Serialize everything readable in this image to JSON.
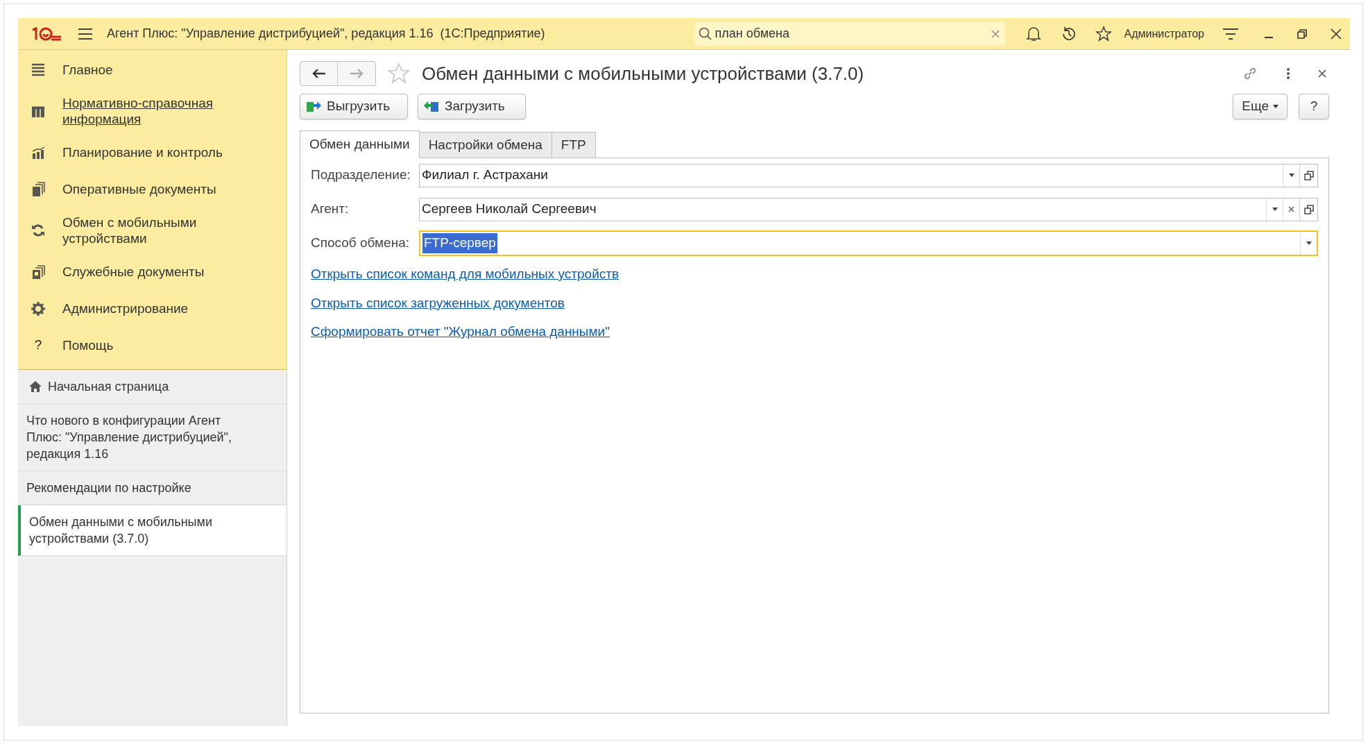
{
  "header": {
    "title": "Агент Плюс: \"Управление дистрибуцией\", редакция 1.16  (1С:Предприятие)",
    "search": {
      "value": "план обмена"
    },
    "user": "Администратор"
  },
  "sidebar": {
    "sections": [
      {
        "label": "Главное",
        "kind": "list",
        "underlined": false
      },
      {
        "label": "Нормативно-справочная информация",
        "kind": "grid",
        "underlined": true
      },
      {
        "label": "Планирование и контроль",
        "kind": "chart",
        "underlined": false
      },
      {
        "label": "Оперативные документы",
        "kind": "docs",
        "underlined": false
      },
      {
        "label": "Обмен с мобильными устройствами",
        "kind": "sync",
        "underlined": false
      },
      {
        "label": "Служебные документы",
        "kind": "service",
        "underlined": false
      },
      {
        "label": "Администрирование",
        "kind": "gear",
        "underlined": false
      },
      {
        "label": "Помощь",
        "kind": "help",
        "icon_char": "?",
        "underlined": false
      }
    ],
    "open_windows": [
      {
        "label": "Начальная страница",
        "kind": "home",
        "selected": false
      },
      {
        "label": "Что нового в конфигурации Агент Плюс: \"Управление дистрибуцией\", редакция 1.16",
        "kind": "page",
        "selected": false
      },
      {
        "label": "Рекомендации по настройке",
        "kind": "page",
        "selected": false
      },
      {
        "label": "Обмен данными с мобильными устройствами (3.7.0)",
        "kind": "page",
        "selected": true
      }
    ]
  },
  "form": {
    "title": "Обмен данными с мобильными устройствами (3.7.0)",
    "favorite": false,
    "back_enabled": true,
    "forward_enabled": false,
    "buttons": [
      {
        "label": "Выгрузить",
        "kind": "upload"
      },
      {
        "label": "Загрузить",
        "kind": "download"
      }
    ],
    "more_button": "Еще",
    "help_button": "?",
    "tabs": [
      {
        "label": "Обмен данными",
        "selected": true
      },
      {
        "label": "Настройки обмена",
        "selected": false
      },
      {
        "label": "FTP",
        "selected": false
      }
    ],
    "fields": [
      {
        "label": "Подразделение:",
        "value": "Филиал г. Астрахани",
        "clear_button": false,
        "open_button": true,
        "focused": false
      },
      {
        "label": "Агент:",
        "value": "Сергеев Николай Сергеевич",
        "clear_button": true,
        "open_button": true,
        "focused": false
      },
      {
        "label": "Способ обмена:",
        "value": "FTP-сервер",
        "clear_button": false,
        "open_button": false,
        "focused": true
      }
    ],
    "links": [
      "Открыть список команд для мобильных устройств",
      "Открыть список загруженных документов",
      "Сформировать отчет \"Журнал обмена данными\""
    ]
  }
}
